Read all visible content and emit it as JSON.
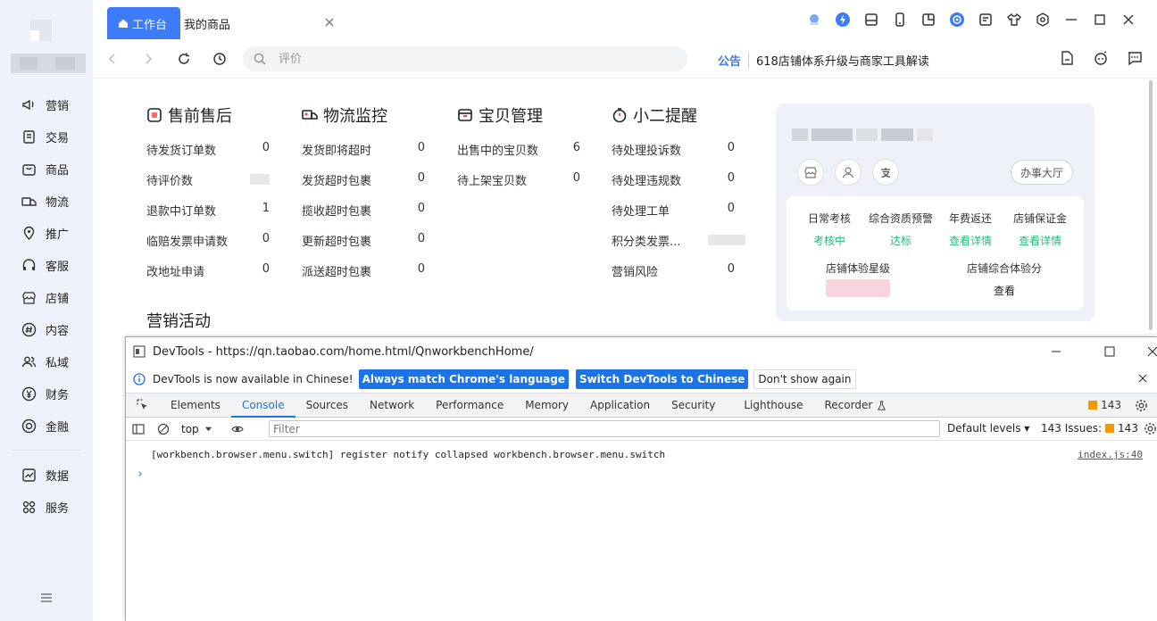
{
  "colors": {
    "accent": "#3d7bf7",
    "success": "#1fbb7a",
    "devtools_blue": "#1a73e8"
  },
  "sidebar": {
    "items": [
      {
        "label": "营销",
        "icon": "megaphone-icon"
      },
      {
        "label": "交易",
        "icon": "receipt-icon"
      },
      {
        "label": "商品",
        "icon": "bag-icon"
      },
      {
        "label": "物流",
        "icon": "truck-icon"
      },
      {
        "label": "推广",
        "icon": "pin-icon"
      },
      {
        "label": "客服",
        "icon": "headset-icon"
      },
      {
        "label": "店铺",
        "icon": "store-icon"
      },
      {
        "label": "内容",
        "icon": "hash-icon"
      },
      {
        "label": "私域",
        "icon": "users-icon"
      },
      {
        "label": "财务",
        "icon": "yen-icon"
      },
      {
        "label": "金融",
        "icon": "target-icon"
      }
    ],
    "items2": [
      {
        "label": "数据",
        "icon": "chart-icon"
      },
      {
        "label": "服务",
        "icon": "grid-icon"
      }
    ]
  },
  "tabs": {
    "active": "工作台",
    "second": "我的商品"
  },
  "navbar": {
    "search_placeholder": "评价",
    "notice_label": "公告",
    "notice_text": "618店铺体系升级与商家工具解读"
  },
  "groups": [
    {
      "title": "售前售后",
      "rows": [
        {
          "label": "待发货订单数",
          "value": "0"
        },
        {
          "label": "待评价数",
          "value": ""
        },
        {
          "label": "退款中订单数",
          "value": "1"
        },
        {
          "label": "临赔发票申请数",
          "value": "0"
        },
        {
          "label": "改地址申请",
          "value": "0"
        }
      ]
    },
    {
      "title": "物流监控",
      "rows": [
        {
          "label": "发货即将超时",
          "value": "0"
        },
        {
          "label": "发货超时包裹",
          "value": "0"
        },
        {
          "label": "揽收超时包裹",
          "value": "0"
        },
        {
          "label": "更新超时包裹",
          "value": "0"
        },
        {
          "label": "派送超时包裹",
          "value": "0"
        }
      ]
    },
    {
      "title": "宝贝管理",
      "rows": [
        {
          "label": "出售中的宝贝数",
          "value": "6"
        },
        {
          "label": "待上架宝贝数",
          "value": "0"
        }
      ]
    },
    {
      "title": "小二提醒",
      "rows": [
        {
          "label": "待处理投诉数",
          "value": "0"
        },
        {
          "label": "待处理违规数",
          "value": "0"
        },
        {
          "label": "待处理工单",
          "value": "0"
        },
        {
          "label": "积分类发票...",
          "value": ""
        },
        {
          "label": "营销风险",
          "value": "0"
        }
      ]
    }
  ],
  "marketing_title": "营销活动",
  "card": {
    "hall_button": "办事大厅",
    "metrics": [
      {
        "label": "日常考核",
        "value": "考核中"
      },
      {
        "label": "综合资质预警",
        "value": "达标"
      },
      {
        "label": "年费返还",
        "value": "查看详情"
      },
      {
        "label": "店铺保证金",
        "value": "查看详情"
      }
    ],
    "metric_star_label": "店铺体验星级",
    "metric_score_label": "店铺综合体验分",
    "metric_score_value": "查看"
  },
  "devtools": {
    "title": "DevTools - https://qn.taobao.com/home.html/QnworkbenchHome/",
    "info_text": "DevTools is now available in Chinese!",
    "btn_match": "Always match Chrome's language",
    "btn_switch": "Switch DevTools to Chinese",
    "btn_dont": "Don't show again",
    "tabs": [
      "Elements",
      "Console",
      "Sources",
      "Network",
      "Performance",
      "Memory",
      "Application",
      "Security",
      "Lighthouse",
      "Recorder"
    ],
    "issues_count": "143",
    "context": "top",
    "filter_placeholder": "Filter",
    "levels": "Default levels",
    "issues_label": "143 Issues:",
    "issues_num": "143",
    "log_text": "[workbench.browser.menu.switch] register notify collapsed workbench.browser.menu.switch",
    "log_source": "index.js:40",
    "prompt": "›"
  }
}
